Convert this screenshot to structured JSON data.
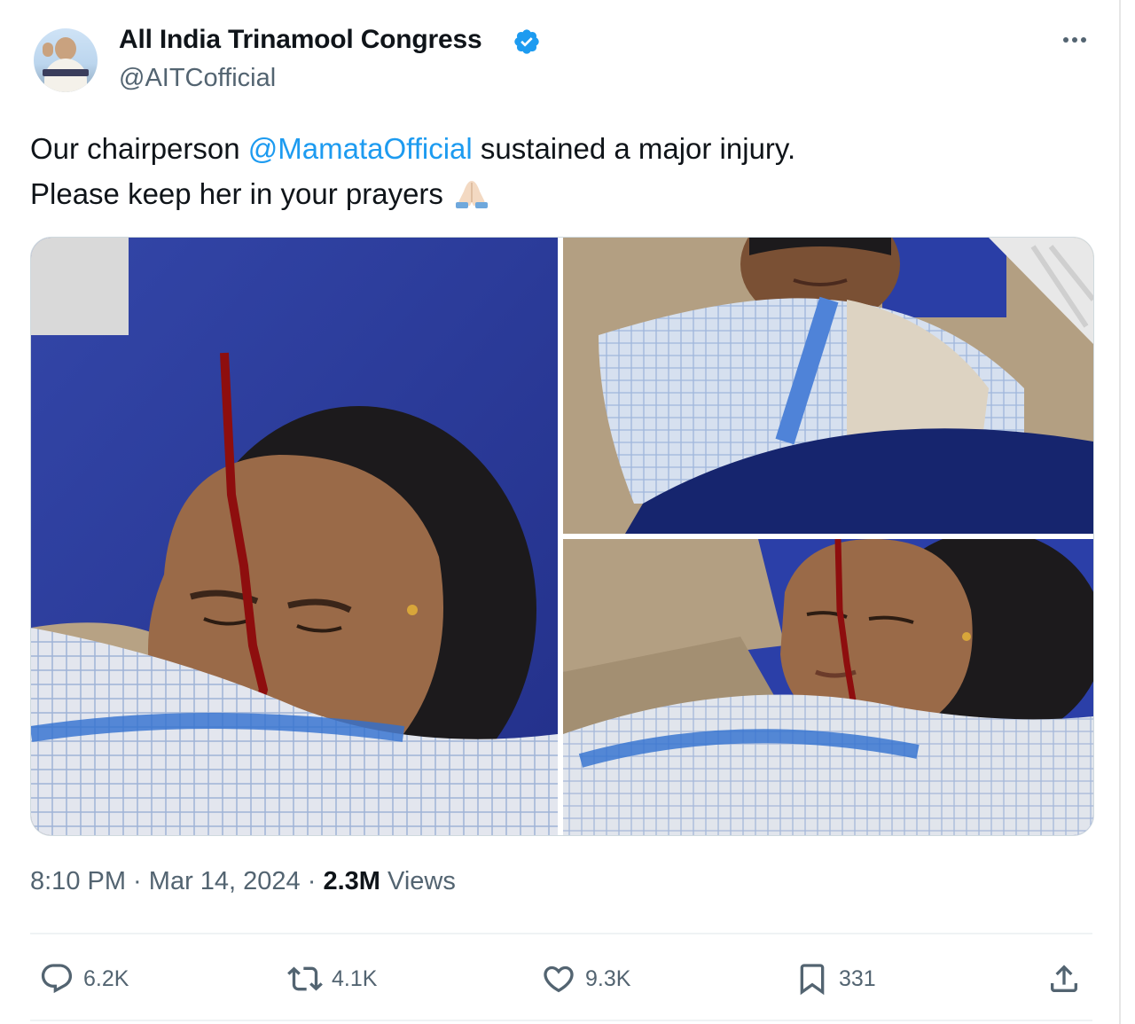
{
  "tweet": {
    "author_name": "All India Trinamool Congress",
    "author_handle": "@AITCofficial",
    "text_before_mention": "Our chairperson ",
    "mention": "@MamataOfficial",
    "text_after_mention": " sustained a major injury.",
    "text_line2": "Please keep her in your prayers",
    "emoji": "folded-hands",
    "time": "8:10 PM",
    "separator": " · ",
    "date": "Mar 14, 2024",
    "views_count": "2.3M",
    "views_label": " Views"
  },
  "stats": {
    "replies": "6.2K",
    "reposts": "4.1K",
    "likes": "9.3K",
    "bookmarks": "331"
  },
  "colors": {
    "accent": "#1d9bf0",
    "text": "#0f1419",
    "secondary": "#536471",
    "border": "#cfd9de"
  },
  "icons": [
    "verified-badge-icon",
    "more-options-icon",
    "reply-icon",
    "repost-icon",
    "like-icon",
    "bookmark-icon",
    "share-icon"
  ]
}
